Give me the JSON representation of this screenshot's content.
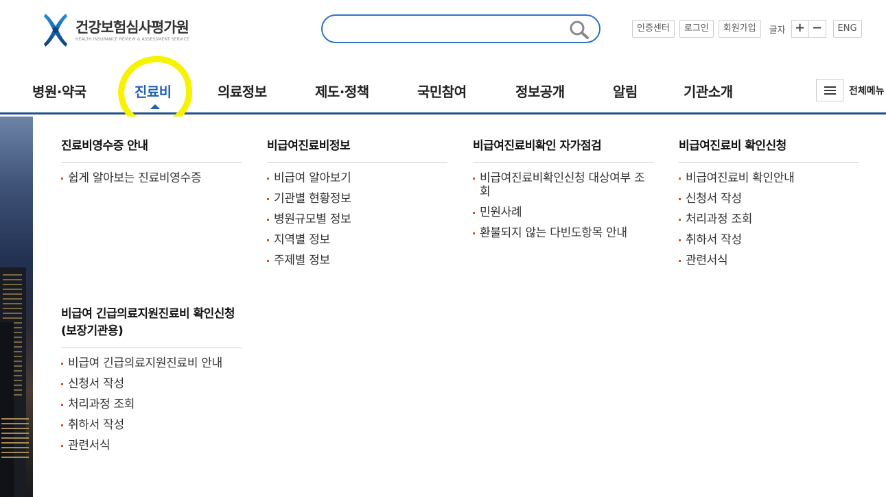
{
  "header": {
    "logo_title": "건강보험심사평가원",
    "logo_subtitle": "HEALTH INSURANCE REVIEW & ASSESSMENT SERVICE",
    "search": {
      "value": "",
      "placeholder": ""
    },
    "util": {
      "cert_center": "인증센터",
      "login": "로그인",
      "join": "회원가입",
      "font_size_label": "글자",
      "font_plus": "+",
      "font_minus": "−",
      "lang": "ENG"
    }
  },
  "gnb": {
    "items": [
      "병원·약국",
      "진료비",
      "의료정보",
      "제도·정책",
      "국민참여",
      "정보공개",
      "알림",
      "기관소개"
    ],
    "active_index": 1,
    "all_menu_label": "전체메뉴"
  },
  "mega_menu": {
    "sections": [
      {
        "title": "진료비영수증 안내",
        "links": [
          "쉽게 알아보는 진료비영수증"
        ]
      },
      {
        "title": "비급여진료비정보",
        "links": [
          "비급여 알아보기",
          "기관별 현황정보",
          "병원규모별 정보",
          "지역별 정보",
          "주제별 정보"
        ]
      },
      {
        "title": "비급여진료비확인 자가점검",
        "links": [
          "비급여진료비확인신청 대상여부 조회",
          "민원사례",
          "환불되지 않는 다빈도항목 안내"
        ]
      },
      {
        "title": "비급여진료비 확인신청",
        "links": [
          "비급여진료비 확인안내",
          "신청서 작성",
          "처리과정 조회",
          "취하서 작성",
          "관련서식"
        ]
      },
      {
        "title": "비급여 긴급의료지원진료비 확인신청(보장기관용)",
        "links": [
          "비급여 긴급의료지원진료비 안내",
          "신청서 작성",
          "처리과정 조회",
          "취하서 작성",
          "관련서식"
        ]
      }
    ]
  },
  "colors": {
    "accent_blue": "#1f5fb5",
    "search_border": "#2b72c8",
    "bullet": "#d64b2a",
    "highlight_annotation": "#f6f200"
  }
}
